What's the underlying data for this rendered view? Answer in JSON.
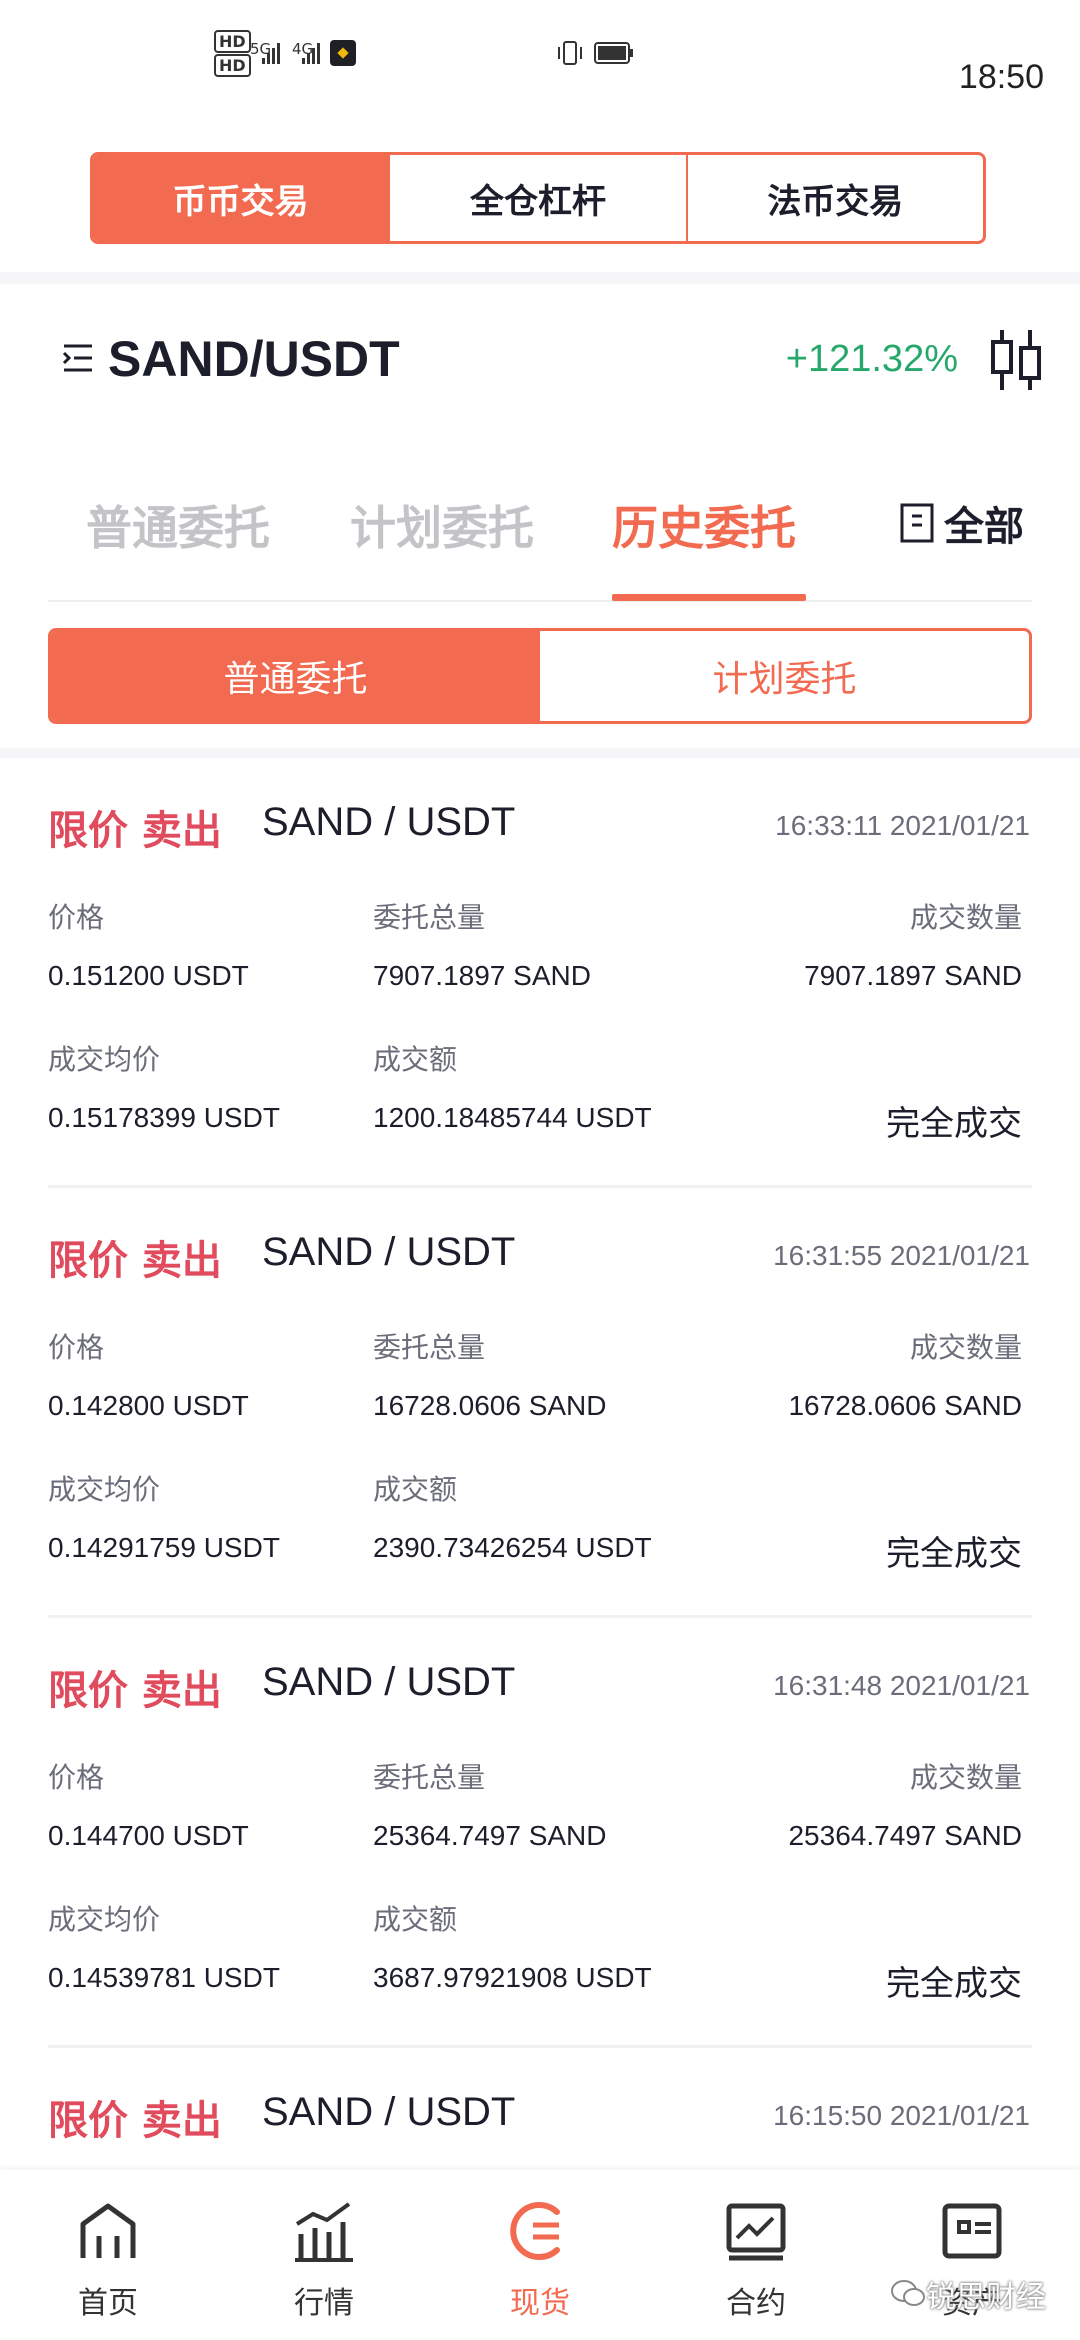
{
  "status_bar": {
    "hd1": "HD",
    "hd2": "HD",
    "sig1": "5G",
    "sig2": "4G",
    "time": "18:50"
  },
  "top_segments": [
    "币币交易",
    "全仓杠杆",
    "法币交易"
  ],
  "pair": {
    "name": "SAND/USDT",
    "change": "+121.32%"
  },
  "tabs": [
    "普通委托",
    "计划委托",
    "历史委托"
  ],
  "filter_label": "全部",
  "sub_segments": [
    "普通委托",
    "计划委托"
  ],
  "labels": {
    "price": "价格",
    "total_amount": "委托总量",
    "filled_qty": "成交数量",
    "avg_price": "成交均价",
    "filled_value": "成交额"
  },
  "orders": [
    {
      "type": "限价 卖出",
      "pair": "SAND / USDT",
      "time": "16:33:11 2021/01/21",
      "price": "0.151200 USDT",
      "total": "7907.1897 SAND",
      "filled": "7907.1897 SAND",
      "avg": "0.15178399 USDT",
      "value": "1200.18485744 USDT",
      "status": "完全成交"
    },
    {
      "type": "限价 卖出",
      "pair": "SAND / USDT",
      "time": "16:31:55 2021/01/21",
      "price": "0.142800 USDT",
      "total": "16728.0606 SAND",
      "filled": "16728.0606 SAND",
      "avg": "0.14291759 USDT",
      "value": "2390.73426254 USDT",
      "status": "完全成交"
    },
    {
      "type": "限价 卖出",
      "pair": "SAND / USDT",
      "time": "16:31:48 2021/01/21",
      "price": "0.144700 USDT",
      "total": "25364.7497 SAND",
      "filled": "25364.7497 SAND",
      "avg": "0.14539781 USDT",
      "value": "3687.97921908 USDT",
      "status": "完全成交"
    },
    {
      "type": "限价 卖出",
      "pair": "SAND / USDT",
      "time": "16:15:50 2021/01/21"
    }
  ],
  "bottom_nav": [
    "首页",
    "行情",
    "现货",
    "合约",
    "资产"
  ],
  "watermark": "锐思财经",
  "colors": {
    "accent": "#f26a4f",
    "sell": "#e04c5e",
    "up": "#27a86b"
  }
}
